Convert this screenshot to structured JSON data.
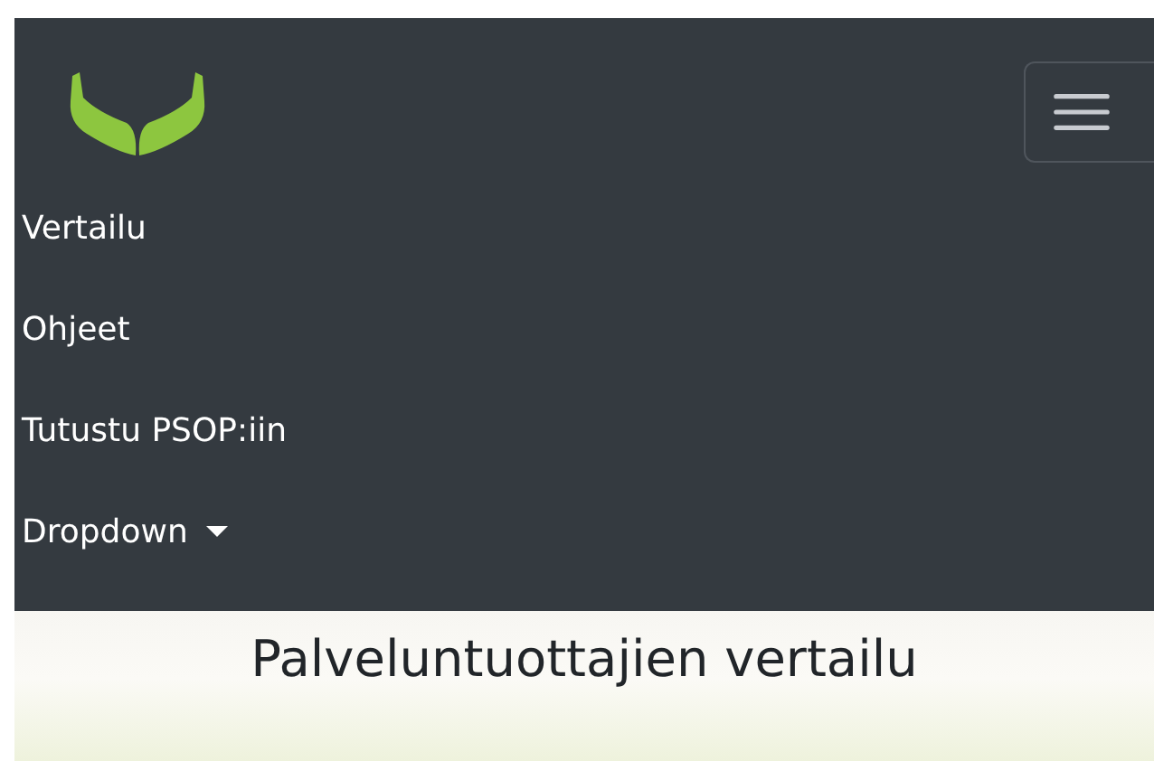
{
  "navbar": {
    "menu_items": [
      {
        "label": "Vertailu",
        "kind": "link"
      },
      {
        "label": "Ohjeet",
        "kind": "link"
      },
      {
        "label": "Tutustu PSOP:iin",
        "kind": "link"
      },
      {
        "label": "Dropdown",
        "kind": "dropdown"
      }
    ]
  },
  "page": {
    "heading": "Palveluntuottajien vertailu"
  }
}
